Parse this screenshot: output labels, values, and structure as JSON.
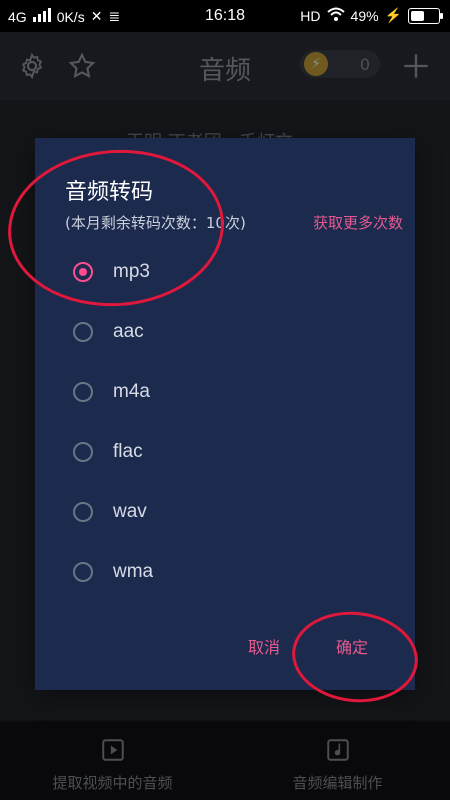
{
  "status_bar": {
    "network": "4G",
    "speed": "0K/s",
    "time": "16:18",
    "hd": "HD",
    "battery_percent": "49%",
    "battery_level": 0.49
  },
  "header": {
    "title": "音频",
    "coin_count": "0"
  },
  "background": {
    "song_text": "王明 丁老团 · 千灯文"
  },
  "bottom_nav": {
    "items": [
      {
        "label": "提取视频中的音频",
        "icon": "video-play-icon"
      },
      {
        "label": "音频编辑制作",
        "icon": "music-note-icon"
      }
    ]
  },
  "dialog": {
    "title": "音频转码",
    "subtitle": "(本月剩余转码次数：10次)",
    "more_link": "获取更多次数",
    "options": [
      {
        "label": "mp3",
        "selected": true
      },
      {
        "label": "aac",
        "selected": false
      },
      {
        "label": "m4a",
        "selected": false
      },
      {
        "label": "flac",
        "selected": false
      },
      {
        "label": "wav",
        "selected": false
      },
      {
        "label": "wma",
        "selected": false
      }
    ],
    "cancel": "取消",
    "confirm": "确定"
  },
  "colors": {
    "accent": "#ff4d8f",
    "dialog_bg": "#1c2a4d",
    "annotation": "#e0183b"
  }
}
